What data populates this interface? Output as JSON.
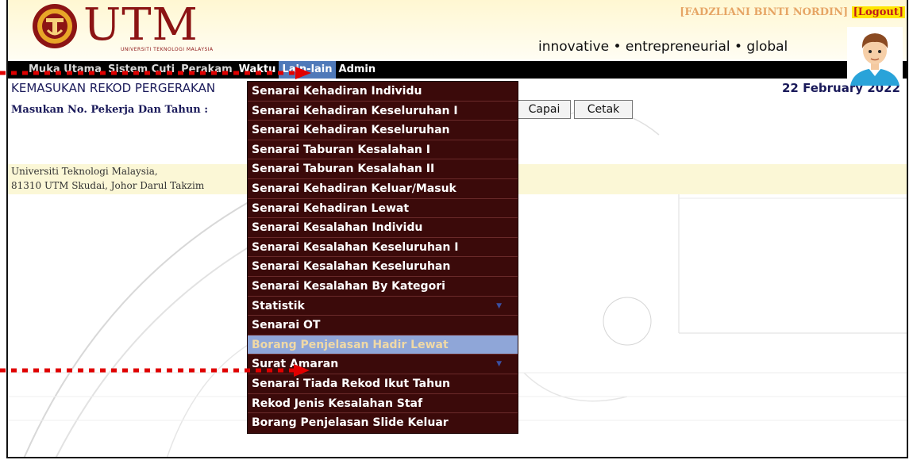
{
  "header": {
    "logo_text": "UTM",
    "logo_subtext": "UNIVERSITI TEKNOLOGI MALAYSIA",
    "tagline": "innovative • entrepreneurial • global",
    "user_name": "[FADZLIANI BINTI NORDIN]",
    "logout_label": "[Logout]"
  },
  "nav": {
    "items": [
      {
        "label": "Muka Utama"
      },
      {
        "label": "Sistem Cuti"
      },
      {
        "label": "Perakam"
      },
      {
        "label": "Waktu"
      },
      {
        "label": "Lain-lain"
      },
      {
        "label": "Admin"
      }
    ]
  },
  "page": {
    "title": "KEMASUKAN REKOD PERGERAKAN",
    "date": "22 February 2022",
    "form_label": "Masukan No. Pekerja Dan Tahun :",
    "capai_button": "Capai",
    "cetak_button": "Cetak"
  },
  "footer": {
    "line1": "Universiti Teknologi Malaysia,",
    "line2": "81310 UTM Skudai, Johor Darul Takzim"
  },
  "dropdown": {
    "items": [
      {
        "label": "Senarai Kehadiran Individu"
      },
      {
        "label": "Senarai Kehadiran Keseluruhan I"
      },
      {
        "label": "Senarai Kehadiran Keseluruhan"
      },
      {
        "label": "Senarai Taburan Kesalahan I"
      },
      {
        "label": "Senarai Taburan Kesalahan II"
      },
      {
        "label": "Senarai Kehadiran Keluar/Masuk"
      },
      {
        "label": "Senarai Kehadiran Lewat"
      },
      {
        "label": "Senarai Kesalahan Individu"
      },
      {
        "label": "Senarai Kesalahan Keseluruhan I"
      },
      {
        "label": "Senarai Kesalahan Keseluruhan"
      },
      {
        "label": "Senarai Kesalahan By Kategori"
      },
      {
        "label": "Statistik",
        "submenu": true
      },
      {
        "label": "Senarai OT"
      },
      {
        "label": "Borang Penjelasan Hadir Lewat",
        "highlighted": true
      },
      {
        "label": "Surat Amaran",
        "submenu": true
      },
      {
        "label": "Senarai Tiada Rekod Ikut Tahun"
      },
      {
        "label": "Rekod Jenis Kesalahan Staf"
      },
      {
        "label": "Borang Penjelasan Slide Keluar"
      }
    ],
    "submenu_arrow": "▼"
  },
  "colors": {
    "accent_nav_active": "#4f79b9",
    "menu_bg": "#3b0a0a",
    "menu_highlight": "#8fa6d8",
    "logo_red": "#8c1414",
    "annotation_red": "#e00000"
  }
}
